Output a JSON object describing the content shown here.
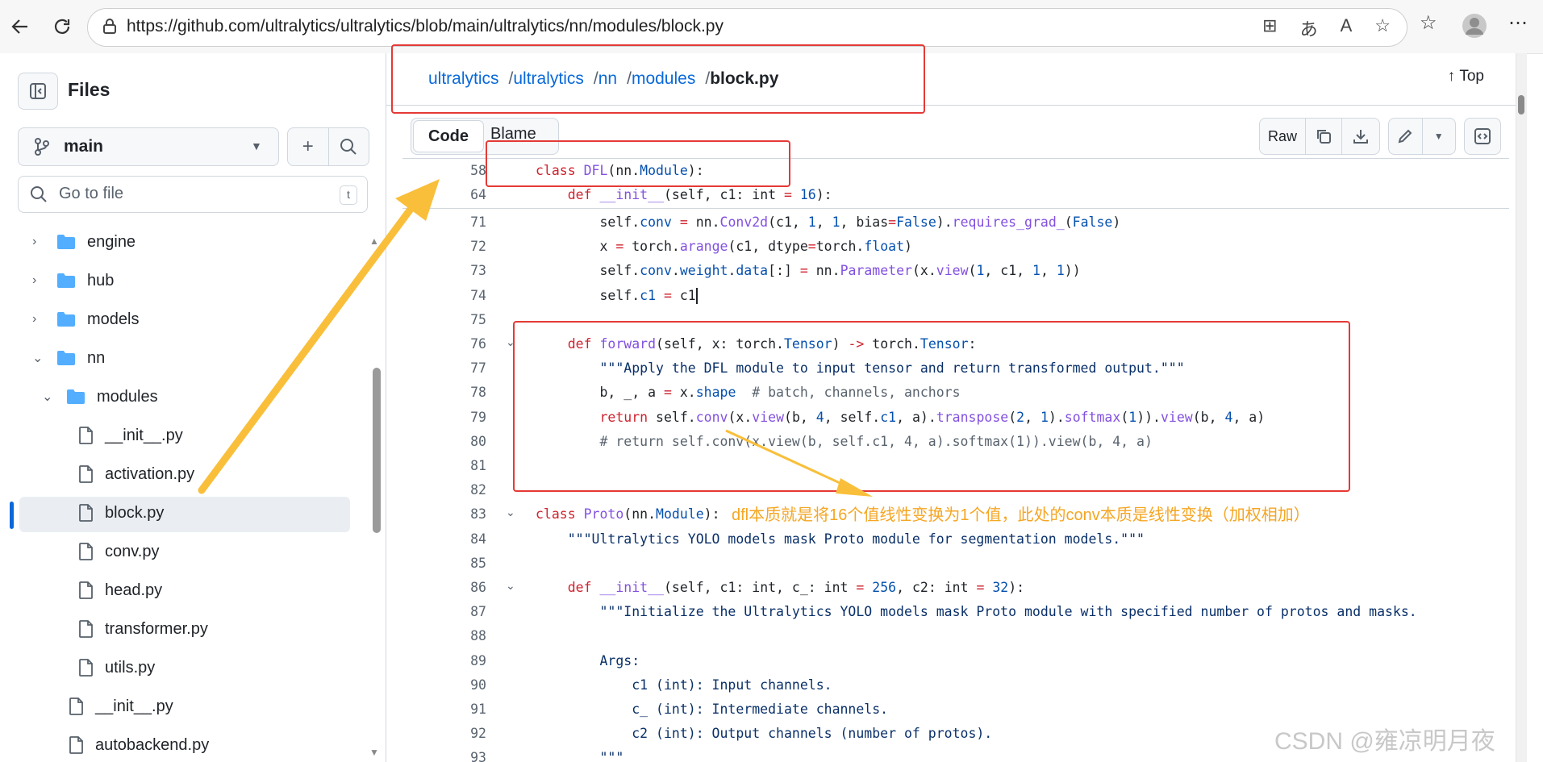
{
  "browser": {
    "url": "https://github.com/ultralytics/ultralytics/blob/main/ultralytics/nn/modules/block.py",
    "back_icon": "back-arrow-icon",
    "refresh_icon": "refresh-icon"
  },
  "sidebar": {
    "title": "Files",
    "branch": "main",
    "goto_placeholder": "Go to file",
    "goto_shortcut": "t",
    "tree": [
      {
        "label": "engine",
        "type": "folder",
        "depth": 0,
        "expanded": false
      },
      {
        "label": "hub",
        "type": "folder",
        "depth": 0,
        "expanded": false
      },
      {
        "label": "models",
        "type": "folder",
        "depth": 0,
        "expanded": false
      },
      {
        "label": "nn",
        "type": "folder",
        "depth": 0,
        "expanded": true
      },
      {
        "label": "modules",
        "type": "folder",
        "depth": 1,
        "expanded": true
      },
      {
        "label": "__init__.py",
        "type": "file",
        "depth": 2
      },
      {
        "label": "activation.py",
        "type": "file",
        "depth": 2
      },
      {
        "label": "block.py",
        "type": "file",
        "depth": 2,
        "selected": true
      },
      {
        "label": "conv.py",
        "type": "file",
        "depth": 2
      },
      {
        "label": "head.py",
        "type": "file",
        "depth": 2
      },
      {
        "label": "transformer.py",
        "type": "file",
        "depth": 2
      },
      {
        "label": "utils.py",
        "type": "file",
        "depth": 2
      },
      {
        "label": "__init__.py",
        "type": "file",
        "depth": 1
      },
      {
        "label": "autobackend.py",
        "type": "file",
        "depth": 1
      }
    ]
  },
  "breadcrumb": {
    "items": [
      "ultralytics",
      "ultralytics",
      "nn",
      "modules"
    ],
    "current": "block.py",
    "top_label": "Top"
  },
  "toolbar": {
    "code_tab": "Code",
    "blame_tab": "Blame",
    "raw_label": "Raw"
  },
  "annotation": {
    "note": "dfl本质就是将16个值线性变换为1个值，此处的conv本质是线性变换（加权相加）",
    "watermark": "CSDN @雍凉明月夜",
    "colors": {
      "box": "#e53935",
      "arrow": "#f9bf3b",
      "note": "#f5a623"
    }
  },
  "sticky_lines": [
    {
      "n": "58",
      "html": "<span class=\"kw\">class</span> <span class=\"fn\">DFL</span>(nn.<span class=\"cn\">Module</span>):"
    },
    {
      "n": "64",
      "html": "    <span class=\"kw\">def</span> <span class=\"fn\">__init__</span>(self, c1: int <span class=\"kw\">=</span> <span class=\"cn\">16</span>):"
    }
  ],
  "code_lines": [
    {
      "n": "71",
      "html": "        self.<span class=\"cn\">conv</span> <span class=\"kw\">=</span> nn.<span class=\"fn\">Conv2d</span>(c1, <span class=\"cn\">1</span>, <span class=\"cn\">1</span>, bias<span class=\"kw\">=</span><span class=\"cn\">False</span>).<span class=\"fn\">requires_grad_</span>(<span class=\"cn\">False</span>)"
    },
    {
      "n": "72",
      "html": "        x <span class=\"kw\">=</span> torch.<span class=\"fn\">arange</span>(c1, dtype<span class=\"kw\">=</span>torch.<span class=\"cn\">float</span>)"
    },
    {
      "n": "73",
      "html": "        self.<span class=\"cn\">conv</span>.<span class=\"cn\">weight</span>.<span class=\"cn\">data</span>[:] <span class=\"kw\">=</span> nn.<span class=\"fn\">Parameter</span>(x.<span class=\"fn\">view</span>(<span class=\"cn\">1</span>, c1, <span class=\"cn\">1</span>, <span class=\"cn\">1</span>))"
    },
    {
      "n": "74",
      "html": "        self.<span class=\"cn\">c1</span> <span class=\"kw\">=</span> c1<span class=\"caret\"></span>"
    },
    {
      "n": "75",
      "html": ""
    },
    {
      "n": "76",
      "fold": true,
      "html": "    <span class=\"kw\">def</span> <span class=\"fn\">forward</span>(self, x: torch.<span class=\"cn\">Tensor</span>) <span class=\"kw\">-&gt;</span> torch.<span class=\"cn\">Tensor</span>:"
    },
    {
      "n": "77",
      "html": "        <span class=\"st\">\"\"\"Apply the DFL module to input tensor and return transformed output.\"\"\"</span>"
    },
    {
      "n": "78",
      "html": "        b, _, a <span class=\"kw\">=</span> x.<span class=\"cn\">shape</span>  <span class=\"cm\"># batch, channels, anchors</span>"
    },
    {
      "n": "79",
      "html": "        <span class=\"kw\">return</span> self.<span class=\"fn\">conv</span>(x.<span class=\"fn\">view</span>(b, <span class=\"cn\">4</span>, self.<span class=\"cn\">c1</span>, a).<span class=\"fn\">transpose</span>(<span class=\"cn\">2</span>, <span class=\"cn\">1</span>).<span class=\"fn\">softmax</span>(<span class=\"cn\">1</span>)).<span class=\"fn\">view</span>(b, <span class=\"cn\">4</span>, a)"
    },
    {
      "n": "80",
      "html": "        <span class=\"cm\"># return self.conv(x.view(b, self.c1, 4, a).softmax(1)).view(b, 4, a)</span>"
    },
    {
      "n": "81",
      "html": ""
    },
    {
      "n": "82",
      "html": ""
    },
    {
      "n": "83",
      "fold": true,
      "html": "<span class=\"kw\">class</span> <span class=\"fn\">Proto</span>(nn.<span class=\"cn\">Module</span>):"
    },
    {
      "n": "84",
      "html": "    <span class=\"st\">\"\"\"Ultralytics YOLO models mask Proto module for segmentation models.\"\"\"</span>"
    },
    {
      "n": "85",
      "html": ""
    },
    {
      "n": "86",
      "fold": true,
      "html": "    <span class=\"kw\">def</span> <span class=\"fn\">__init__</span>(self, c1: int, c_: int <span class=\"kw\">=</span> <span class=\"cn\">256</span>, c2: int <span class=\"kw\">=</span> <span class=\"cn\">32</span>):"
    },
    {
      "n": "87",
      "html": "        <span class=\"st\">\"\"\"Initialize the Ultralytics YOLO models mask Proto module with specified number of protos and masks.</span>"
    },
    {
      "n": "88",
      "html": ""
    },
    {
      "n": "89",
      "html": "        <span class=\"st\">Args:</span>"
    },
    {
      "n": "90",
      "html": "            <span class=\"st\">c1 (int): Input channels.</span>"
    },
    {
      "n": "91",
      "html": "            <span class=\"st\">c_ (int): Intermediate channels.</span>"
    },
    {
      "n": "92",
      "html": "            <span class=\"st\">c2 (int): Output channels (number of protos).</span>"
    },
    {
      "n": "93",
      "html": "        <span class=\"st\">\"\"\"</span>"
    }
  ]
}
